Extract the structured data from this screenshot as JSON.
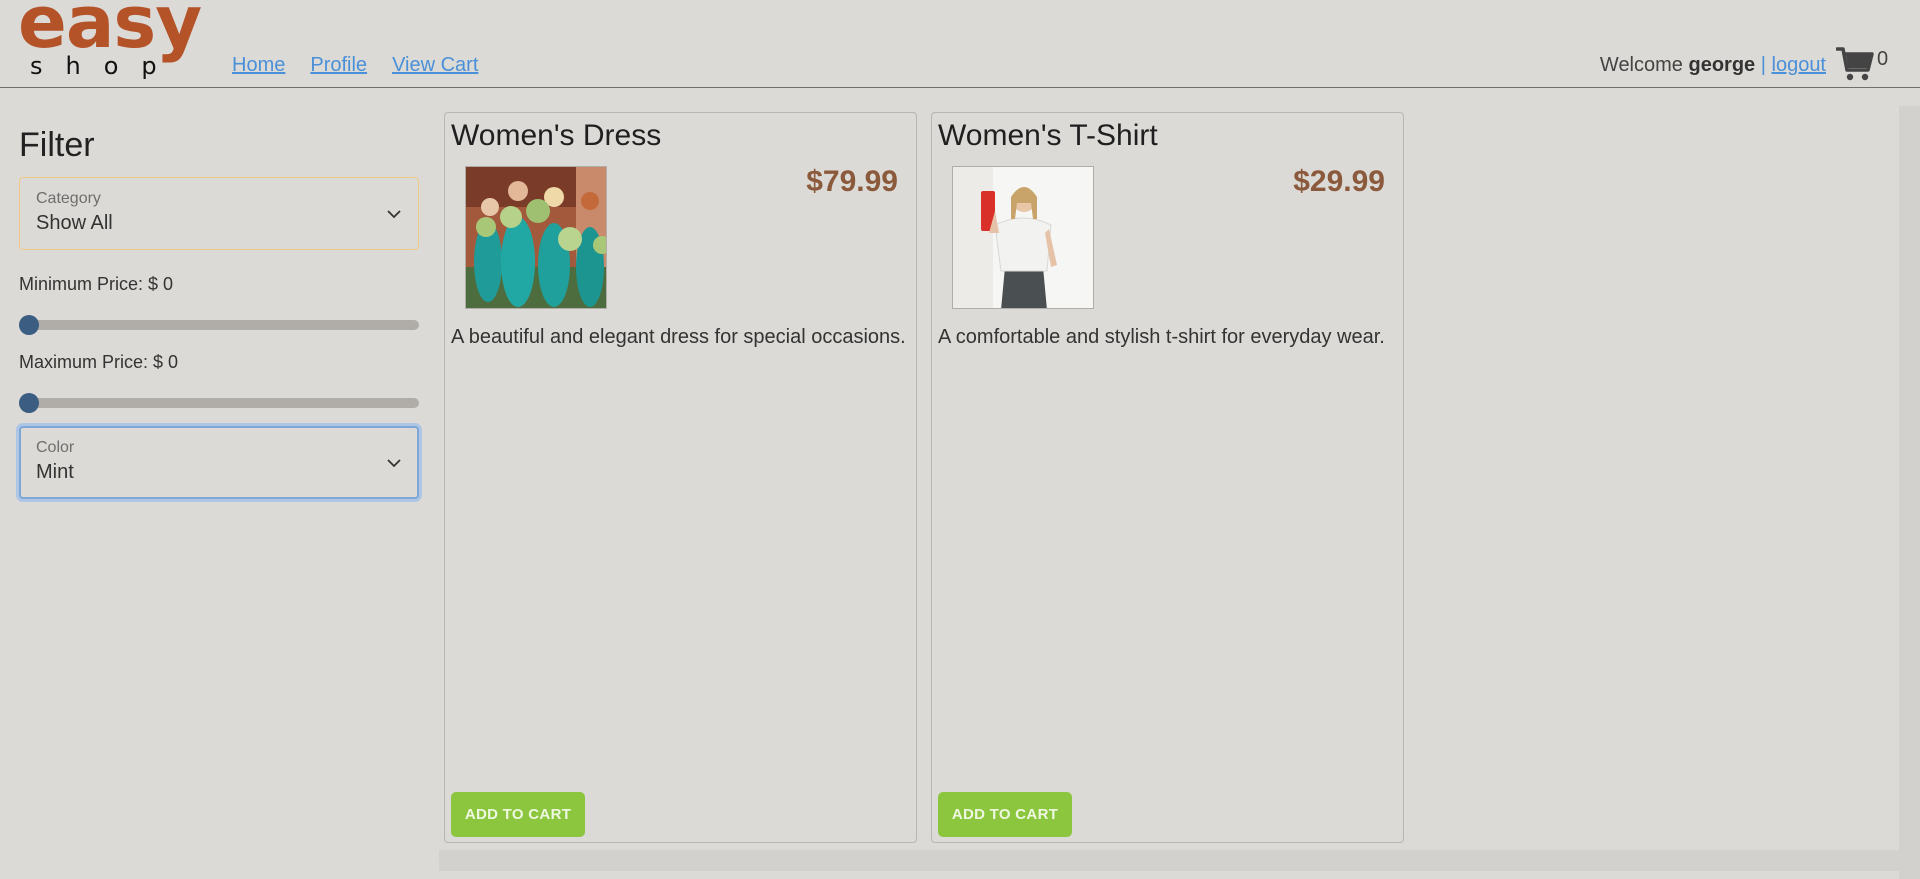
{
  "logo": {
    "brand_top": "easy",
    "brand_bottom": "shop"
  },
  "nav": {
    "home": "Home",
    "profile": "Profile",
    "view_cart": "View Cart"
  },
  "user": {
    "welcome": "Welcome",
    "name": "george",
    "separator": "|",
    "logout": "logout"
  },
  "cart": {
    "icon": "shopping-cart-icon",
    "count": "0"
  },
  "filter": {
    "title": "Filter",
    "category": {
      "label": "Category",
      "value": "Show All"
    },
    "min_price": {
      "label": "Minimum Price: $ 0",
      "value": 0
    },
    "max_price": {
      "label": "Maximum Price: $ 0",
      "value": 0
    },
    "color": {
      "label": "Color",
      "value": "Mint"
    }
  },
  "products": [
    {
      "title": "Women's Dress",
      "price": "$79.99",
      "description": "A beautiful and elegant dress for special occasions.",
      "button": "ADD TO CART"
    },
    {
      "title": "Women's T-Shirt",
      "price": "$29.99",
      "description": "A comfortable and stylish t-shirt for everyday wear.",
      "button": "ADD TO CART"
    }
  ],
  "colors": {
    "brand": "#b45228",
    "link": "#4a90d9",
    "price": "#8b5a3c",
    "button": "#8cc63f",
    "slider_thumb": "#3b5d82"
  }
}
